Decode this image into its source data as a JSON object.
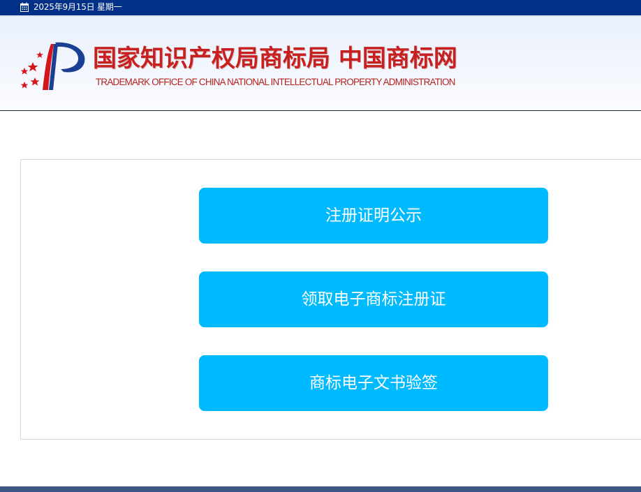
{
  "topbar": {
    "date_text": "2025年9月15日 星期一"
  },
  "header": {
    "title_cn": "国家知识产权局商标局 中国商标网",
    "title_en": "TRADEMARK OFFICE OF CHINA NATIONAL INTELLECTUAL PROPERTY ADMINISTRATION"
  },
  "main": {
    "buttons": [
      {
        "label": "注册证明公示"
      },
      {
        "label": "领取电子商标注册证"
      },
      {
        "label": "商标电子文书验签"
      }
    ]
  },
  "colors": {
    "topbar_bg": "#003087",
    "brand_red": "#c8201e",
    "button_bg": "#00baff",
    "footer_bg": "#3b5584"
  }
}
